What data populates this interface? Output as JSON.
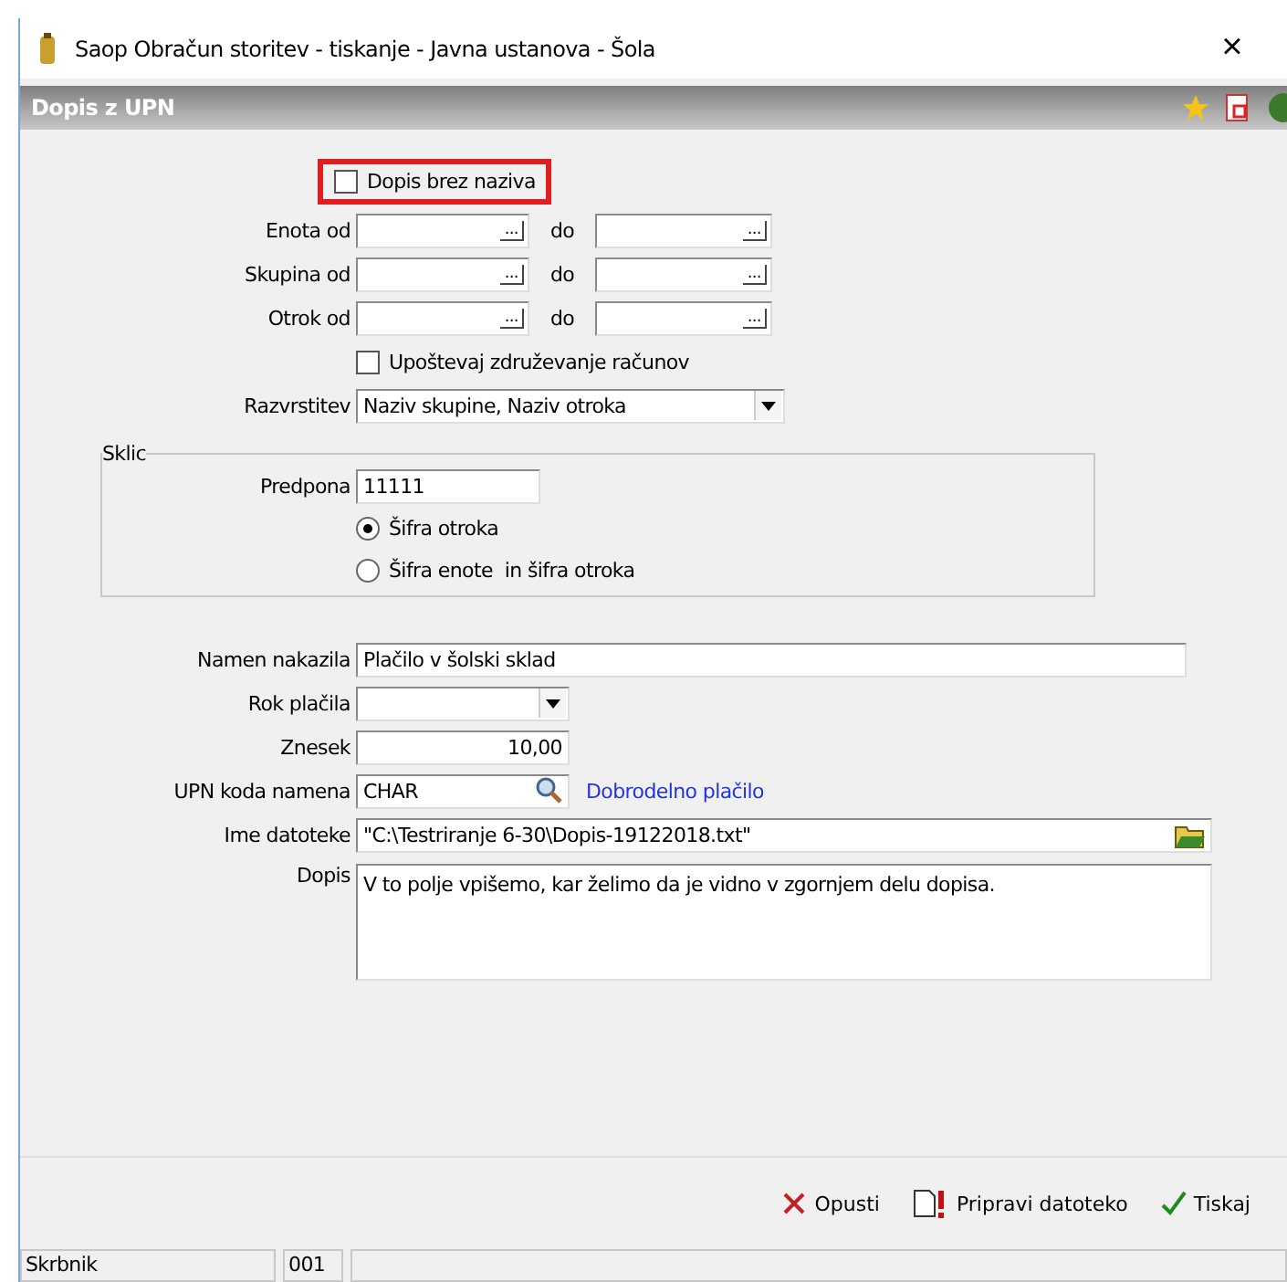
{
  "window": {
    "title": "Saop Obračun storitev - tiskanje - Javna ustanova - Šola",
    "close": "×"
  },
  "form": {
    "title": "Dopis z UPN"
  },
  "top_option": {
    "label": "Dopis brez naziva",
    "checked": false,
    "highlighted": true
  },
  "ranges": [
    {
      "label": "Enota od",
      "to_label": "do",
      "button": "...",
      "button_2": "..."
    },
    {
      "label": "Skupina od",
      "to_label": "do",
      "button": "...",
      "button_2": "..."
    },
    {
      "label": "Otrok od",
      "to_label": "do",
      "button": "...",
      "button_2": "..."
    }
  ],
  "merge_option": {
    "label": "Upoštevaj združevanje računov",
    "checked": false
  },
  "sort": {
    "label": "Razvrstitev",
    "value": "Naziv skupine, Naziv otroka"
  },
  "reference": {
    "title": "Sklic",
    "prefix_label": "Predpona",
    "prefix_value": "11111",
    "options": [
      {
        "label": "Šifra otroka",
        "selected": true
      },
      {
        "label": "Šifra enote  in šifra otroka",
        "selected": false
      }
    ]
  },
  "fields": [
    {
      "kind": "text",
      "label": "Namen nakazila",
      "value": "Plačilo v šolski sklad"
    },
    {
      "kind": "select",
      "label": "Rok plačila"
    },
    {
      "kind": "number",
      "label": "Znesek",
      "value": "10,00"
    },
    {
      "kind": "lookup",
      "label": "UPN koda namena",
      "value": "CHAR",
      "link": "Dobrodelno plačilo"
    },
    {
      "kind": "file",
      "label": "Ime datoteke",
      "value": "\"C:\\Testriranje 6-30\\Dopis-19122018.txt\""
    },
    {
      "kind": "memo",
      "label": "Dopis",
      "value": "V to polje vpišemo, kar želimo da je vidno v zgornjem delu dopisa."
    }
  ],
  "buttons": [
    {
      "kind": "cancel",
      "label": "Opusti"
    },
    {
      "kind": "prepare",
      "label": "Pripravi datoteko"
    },
    {
      "kind": "print",
      "label": "Tiskaj"
    }
  ],
  "status_bar": [
    "Skrbnik",
    "001"
  ]
}
